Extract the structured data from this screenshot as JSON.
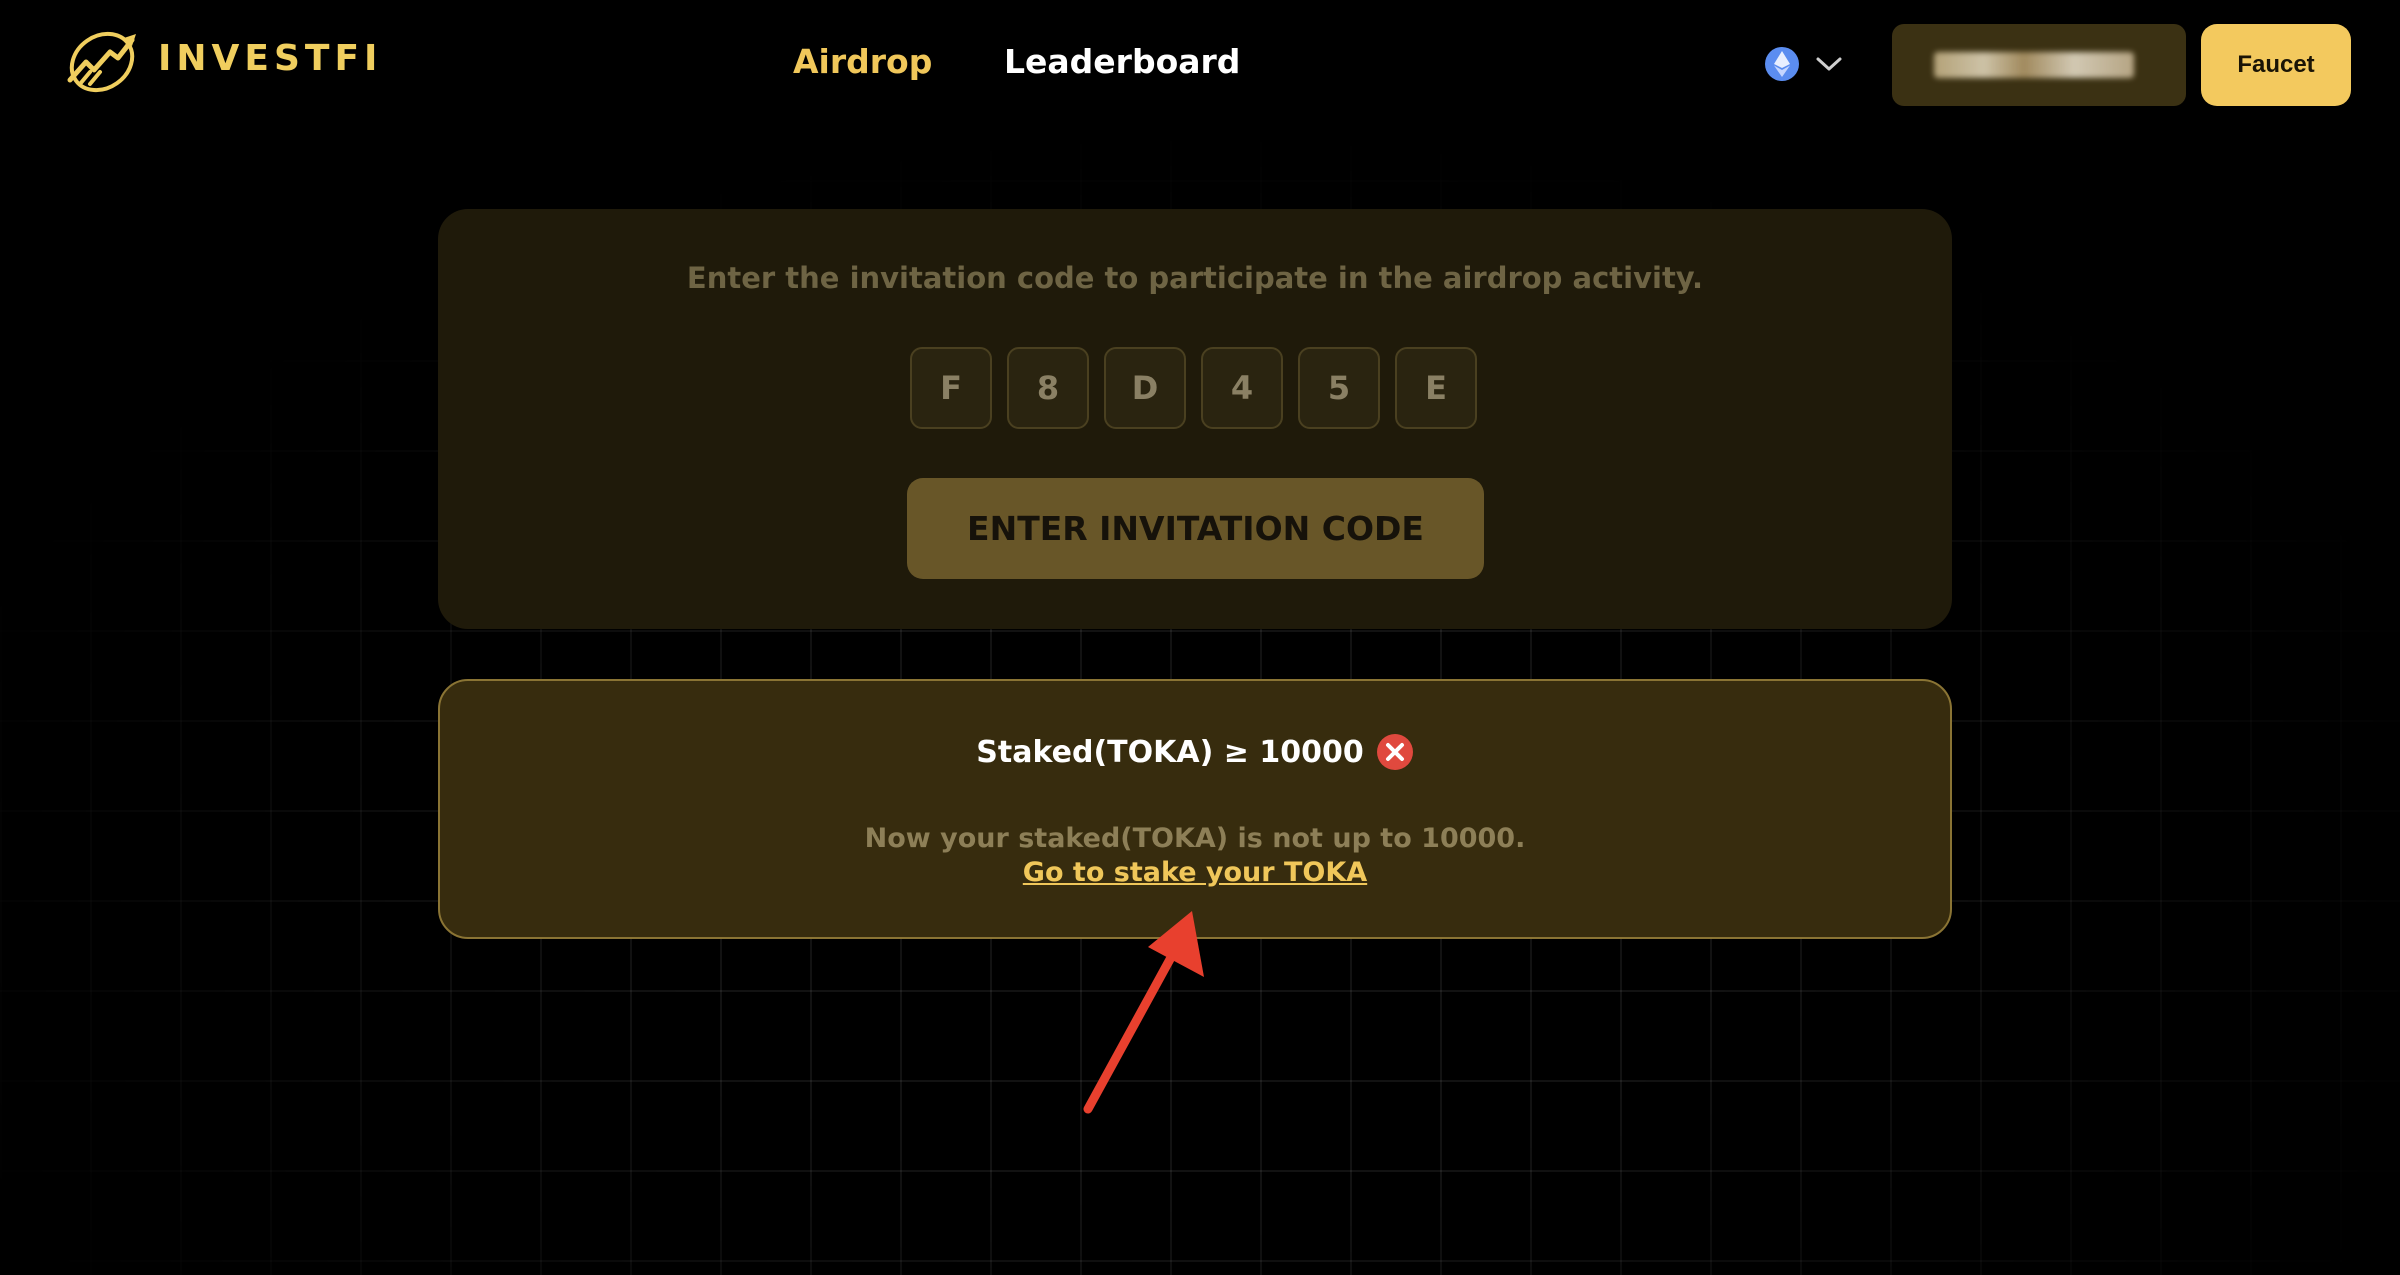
{
  "header": {
    "brand": "INVESTFI",
    "nav": [
      {
        "label": "Airdrop",
        "active": true
      },
      {
        "label": "Leaderboard",
        "active": false
      }
    ],
    "network_icon": "ethereum-icon",
    "wallet_address_blurred": true,
    "faucet_label": "Faucet"
  },
  "invite": {
    "prompt": "Enter the invitation code to participate in the airdrop activity.",
    "code": [
      "F",
      "8",
      "D",
      "4",
      "5",
      "E"
    ],
    "button_label": "ENTER INVITATION CODE"
  },
  "requirement": {
    "title": "Staked(TOKA) ≥ 10000",
    "status_icon": "close-circle-icon",
    "description": "Now your staked(TOKA) is not up to 10000.",
    "link_label": "Go to stake your TOKA"
  },
  "colors": {
    "accent": "#f0c75a",
    "background": "#000000",
    "error": "#e0493e",
    "annotation_arrow": "#e8402e"
  }
}
